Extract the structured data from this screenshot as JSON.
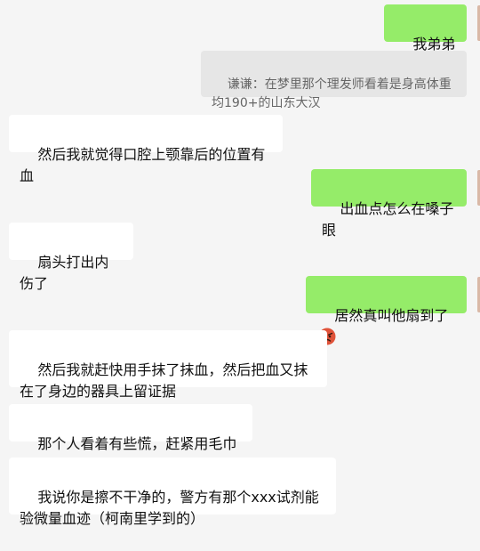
{
  "messages": [
    {
      "side": "right",
      "text": "我弟弟吗"
    },
    {
      "side": "quote",
      "text": "谦谦：在梦里那个理发师看着是身高体重均190+的山东大汉"
    },
    {
      "side": "left",
      "text": "然后我就觉得口腔上颚靠后的位置有血"
    },
    {
      "side": "right",
      "text": "出血点怎么在嗓子眼"
    },
    {
      "side": "left",
      "text": "扇头打出内伤了"
    },
    {
      "side": "right",
      "text": "居然真叫他扇到了",
      "emoji": "angry-face-emoji"
    },
    {
      "side": "left",
      "text": "然后我就赶快用手抹了抹血，然后把血又抹在了身边的器具上留证据"
    },
    {
      "side": "left",
      "text": "那个人看着有些慌，赶紧用毛巾擦"
    },
    {
      "side": "left",
      "text": "我说你是擦不干净的，警方有那个xxx试剂能验微量血迹（柯南里学到的）"
    }
  ],
  "colors": {
    "background": "#f5f5f5",
    "bubble_self": "#95ec69",
    "bubble_other": "#ffffff",
    "quote_bg": "#e6e6e6",
    "quote_text": "#666666"
  }
}
